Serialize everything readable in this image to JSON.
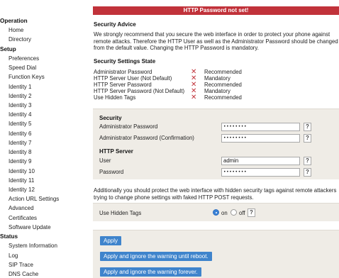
{
  "sidebar": {
    "sections": [
      {
        "title": "Operation",
        "items": [
          "Home",
          "Directory"
        ]
      },
      {
        "title": "Setup",
        "items": [
          "Preferences",
          "Speed Dial",
          "Function Keys",
          "Identity 1",
          "Identity 2",
          "Identity 3",
          "Identity 4",
          "Identity 5",
          "Identity 6",
          "Identity 7",
          "Identity 8",
          "Identity 9",
          "Identity 10",
          "Identity 11",
          "Identity 12",
          "Action URL Settings",
          "Advanced",
          "Certificates",
          "Software Update"
        ]
      },
      {
        "title": "Status",
        "items": [
          "System Information",
          "Log",
          "SIP Trace",
          "DNS Cache"
        ]
      }
    ]
  },
  "banner": "HTTP Password not set!",
  "advice": {
    "title": "Security Advice",
    "text": "We strongly recommend that you secure the web interface in order to protect your phone against remote attacks. Therefore the HTTP User as well as the Administrator Password should be changed from the default value. Changing the HTTP Password is mandatory."
  },
  "state": {
    "title": "Security Settings State",
    "rows": [
      {
        "label": "Administrator Password",
        "mark": "✕",
        "status": "Recommended"
      },
      {
        "label": "HTTP Server User (Not Default)",
        "mark": "✕",
        "status": "Mandatory"
      },
      {
        "label": "HTTP Server Password",
        "mark": "✕",
        "status": "Recommended"
      },
      {
        "label": "HTTP Server Password (Not Default)",
        "mark": "✕",
        "status": "Mandatory"
      },
      {
        "label": "Use Hidden Tags",
        "mark": "✕",
        "status": "Recommended"
      }
    ]
  },
  "security_panel": {
    "title": "Security",
    "admin_pw_label": "Administrator Password",
    "admin_pw_value": "••••••••",
    "admin_pw_confirm_label": "Administrator Password (Confirmation)",
    "admin_pw_confirm_value": "••••••••",
    "http_title": "HTTP Server",
    "user_label": "User",
    "user_value": "admin",
    "password_label": "Password",
    "password_value": "••••••••",
    "help": "?"
  },
  "hidden_tags": {
    "text": "Additionally you should protect the web interface with hidden security tags against remote attackers trying to change phone settings with faked HTTP POST requests.",
    "label": "Use Hidden Tags",
    "on_label": "on",
    "off_label": "off",
    "selected": "on",
    "help": "?"
  },
  "buttons": {
    "apply": "Apply",
    "apply_reboot": "Apply and ignore the warning until reboot.",
    "apply_forever": "Apply and ignore the warning forever."
  },
  "colors": {
    "banner": "#c1323a",
    "button": "#3f84cc",
    "panel": "#efece6",
    "radio_on": "#3b82d6"
  }
}
